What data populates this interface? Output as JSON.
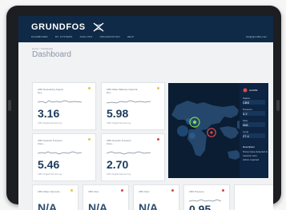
{
  "app": {
    "brand": "GRUNDFOS",
    "nav": [
      "DASHBOARD",
      "MY SYSTEMS",
      "ANALYSIS",
      "ORGANISATION",
      "HELP"
    ],
    "user": "info@grundfos.com",
    "breadcrumb": "Home > Dashboard",
    "title": "Dashboard"
  },
  "cards": [
    {
      "label": "CBS Networking Supply Net...",
      "value": "3.16",
      "sub": "CBS Digital Monitoring",
      "status_color": "#e3c64a"
    },
    {
      "label": "CBS Water Balance Network Ret...",
      "value": "5.98",
      "sub": "CBS Digital Monitoring",
      "status_color": "#e3c64a"
    },
    {
      "label": "CBS Network Pressure Zone...",
      "value": "5.46",
      "sub": "CBS Digital Monitoring",
      "status_color": "#e3c64a"
    },
    {
      "label": "CBS Network Pressure Zone...",
      "value": "2.70",
      "sub": "CBS Digital Monitoring",
      "status_color": "#d64545"
    },
    {
      "label": "CBS Water Demand...",
      "value": "N/A",
      "sub": "",
      "status_color": "#e3c64a"
    },
    {
      "label": "CBS Flow",
      "value": "N/A",
      "sub": "",
      "status_color": "#d64545"
    },
    {
      "label": "CBS Flow",
      "value": "N/A",
      "sub": "",
      "status_color": "#d64545"
    },
    {
      "label": "CBS Pressure",
      "value": "0.95",
      "sub": "",
      "status_color": "#d64545"
    }
  ],
  "map": {
    "panel": {
      "alarm": "ALARM",
      "rows": [
        {
          "label": "Station",
          "value": "CBS"
        },
        {
          "label": "Pressure",
          "value": "3.2"
        },
        {
          "label": "Flow",
          "value": "N/A"
        },
        {
          "label": "Level",
          "value": "27.4"
        }
      ],
      "notes_title": "Description",
      "note_lines": [
        "Pump issue detected in",
        "network zone",
        "Action required"
      ]
    },
    "markers": [
      {
        "name": "marker-africa",
        "color": "#7ed957"
      },
      {
        "name": "marker-alert",
        "color": "#e24949"
      }
    ]
  }
}
